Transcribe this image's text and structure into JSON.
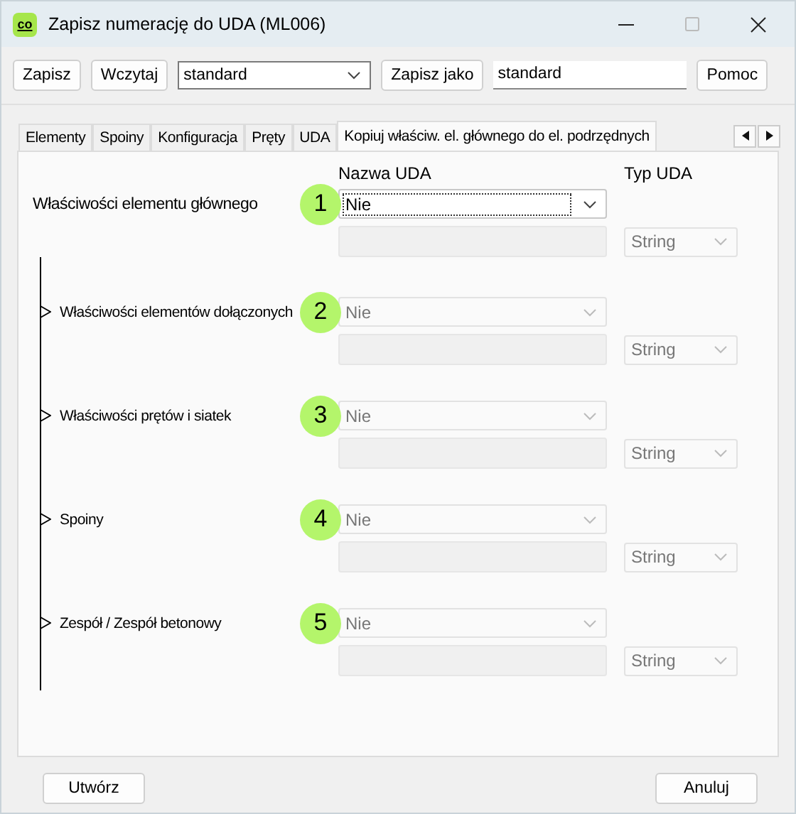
{
  "window": {
    "icon_text": "co",
    "title": "Zapisz numerację do UDA (ML006)"
  },
  "toolbar": {
    "save_button": "Zapisz",
    "load_button": "Wczytaj",
    "preset": "standard",
    "save_as_button": "Zapisz jako",
    "save_as_name": "standard",
    "help_button": "Pomoc"
  },
  "tabs": [
    {
      "label": "Elementy",
      "selected": false
    },
    {
      "label": "Spoiny",
      "selected": false
    },
    {
      "label": "Konfiguracja",
      "selected": false
    },
    {
      "label": "Pręty",
      "selected": false
    },
    {
      "label": "UDA",
      "selected": false
    },
    {
      "label": "Kopiuj właściw. el. głównego do el. podrzędnych",
      "selected": true
    }
  ],
  "columns": {
    "name_header": "Nazwa UDA",
    "type_header": "Typ UDA"
  },
  "root": {
    "label": "Właściwości elementu głównego",
    "badge": "1",
    "uda_name": "Nie",
    "disabled": false,
    "type": "String",
    "children": [
      {
        "label": "Właściwości elementów dołączonych",
        "badge": "2",
        "uda_name": "Nie",
        "disabled": true,
        "type": "String"
      },
      {
        "label": "Właściwości prętów i siatek",
        "badge": "3",
        "uda_name": "Nie",
        "disabled": true,
        "type": "String"
      },
      {
        "label": "Spoiny",
        "badge": "4",
        "uda_name": "Nie",
        "disabled": true,
        "type": "String"
      },
      {
        "label": "Zespół / Zespół betonowy",
        "badge": "5",
        "uda_name": "Nie",
        "disabled": true,
        "type": "String"
      }
    ]
  },
  "footer": {
    "create_button": "Utwórz",
    "cancel_button": "Anuluj"
  }
}
